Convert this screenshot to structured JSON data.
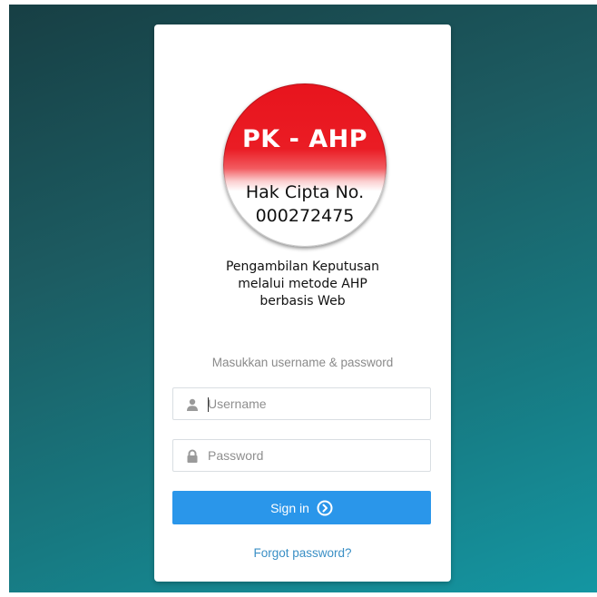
{
  "logo": {
    "title": "PK - AHP",
    "line1": "Hak Cipta No.",
    "line2": "000272475"
  },
  "tagline": {
    "line1": "Pengambilan Keputusan",
    "line2": "melalui metode AHP",
    "line3": "berbasis Web"
  },
  "login": {
    "hint": "Masukkan username & password",
    "username_placeholder": "Username",
    "password_placeholder": "Password",
    "signin_label": "Sign in",
    "forgot_label": "Forgot password?"
  },
  "icons": {
    "username": "user-icon",
    "password": "lock-icon",
    "signin": "circle-arrow-right-icon"
  },
  "colors": {
    "background_top": "#173f44",
    "background_bottom": "#1496a2",
    "button": "#2a96ea",
    "link": "#3a8fc5",
    "logo_red": "#e8141d"
  }
}
